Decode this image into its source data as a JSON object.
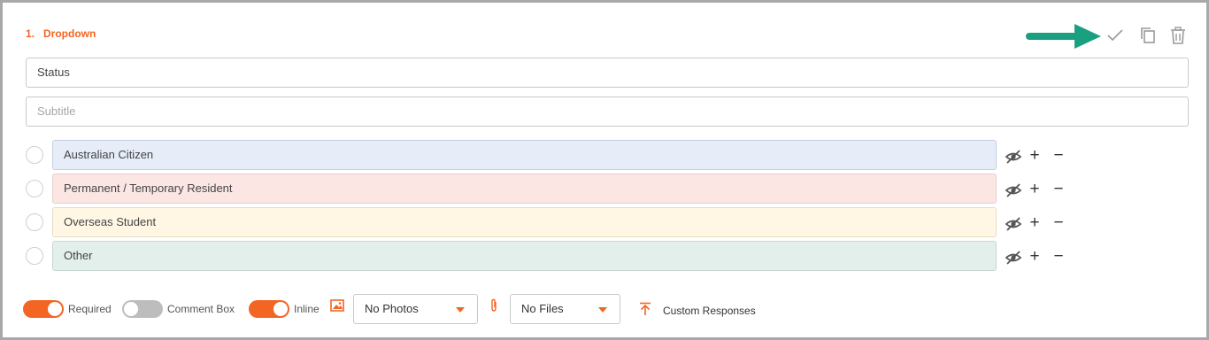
{
  "question": {
    "number": "1.",
    "type_label": "Dropdown",
    "title_value": "Status",
    "subtitle_placeholder": "Subtitle"
  },
  "toolbar": {
    "icons": [
      "check-icon",
      "copy-icon",
      "trash-icon"
    ],
    "annotation_arrow_color": "#1aa080"
  },
  "options": [
    {
      "label": "Australian Citizen",
      "color": "#e6edf8"
    },
    {
      "label": "Permanent / Temporary Resident",
      "color": "#fbe6e4"
    },
    {
      "label": "Overseas Student",
      "color": "#fff7e4"
    },
    {
      "label": "Other",
      "color": "#e3efea"
    }
  ],
  "footer": {
    "required_label": "Required",
    "required_on": true,
    "comment_box_label": "Comment Box",
    "comment_box_on": false,
    "inline_label": "Inline",
    "inline_on": true,
    "photos_value": "No Photos",
    "files_value": "No Files",
    "custom_responses_label": "Custom Responses"
  },
  "colors": {
    "accent": "#f26522",
    "frame_border": "#a8a8a8"
  }
}
